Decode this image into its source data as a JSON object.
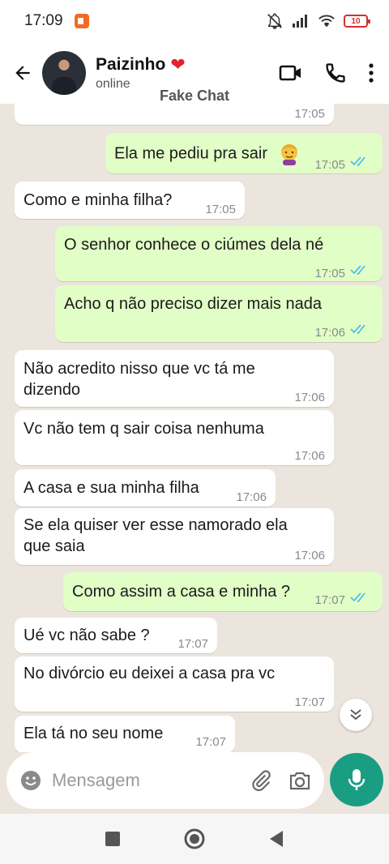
{
  "status_bar": {
    "time": "17:09",
    "battery": "10"
  },
  "header": {
    "contact_name": "Paizinho",
    "contact_emoji": "❤",
    "contact_status": "online",
    "watermark": "Fake Chat"
  },
  "messages": [
    {
      "dir": "in",
      "text": "",
      "time": "17:05"
    },
    {
      "dir": "out",
      "text": "Ela me pediu pra sair",
      "time": "17:05"
    },
    {
      "dir": "in",
      "text": "Como e minha filha?",
      "time": "17:05"
    },
    {
      "dir": "out",
      "text": "O senhor conhece o ciúmes dela né",
      "time": "17:05"
    },
    {
      "dir": "out",
      "text": "Acho q não preciso dizer mais nada",
      "time": "17:06"
    },
    {
      "dir": "in",
      "text_line1": "Não acredito nisso que vc tá me",
      "text_line2": "dizendo",
      "time": "17:06"
    },
    {
      "dir": "in",
      "text": "Vc não tem q sair coisa nenhuma",
      "time": "17:06"
    },
    {
      "dir": "in",
      "text": "A casa e sua minha filha",
      "time": "17:06"
    },
    {
      "dir": "in",
      "text_line1": "Se ela quiser ver esse namorado ela",
      "text_line2": "que saia",
      "time": "17:06"
    },
    {
      "dir": "out",
      "text": "Como assim a casa e minha ?",
      "time": "17:07"
    },
    {
      "dir": "in",
      "text": "Ué vc não sabe ?",
      "time": "17:07"
    },
    {
      "dir": "in",
      "text": "No divórcio eu deixei a casa pra vc",
      "time": "17:07"
    },
    {
      "dir": "in",
      "text": "Ela tá no seu nome",
      "time": "17:07"
    }
  ],
  "input": {
    "placeholder": "Mensagem"
  },
  "colors": {
    "outgoing_bubble": "#e1fec6",
    "incoming_bubble": "#ffffff",
    "accent": "#1a9e83",
    "read_tick": "#53bdeb"
  },
  "icons": [
    "back-arrow-icon",
    "video-call-icon",
    "phone-icon",
    "more-vert-icon",
    "emoji-icon",
    "attach-icon",
    "camera-icon",
    "mic-icon",
    "scroll-down-icon"
  ]
}
